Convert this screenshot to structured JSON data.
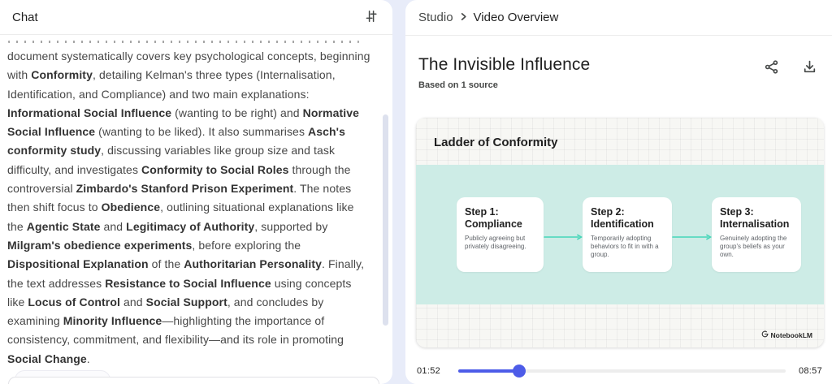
{
  "chat": {
    "title": "Chat",
    "summary_segments": [
      {
        "t": "document systematically covers key psychological concepts, beginning with ",
        "b": false
      },
      {
        "t": "Conformity",
        "b": true
      },
      {
        "t": ", detailing Kelman's three types (Internalisation, Identification, and Compliance) and two main explanations: ",
        "b": false
      },
      {
        "t": "Informational Social Influence",
        "b": true
      },
      {
        "t": " (wanting to be right) and ",
        "b": false
      },
      {
        "t": "Normative Social Influence",
        "b": true
      },
      {
        "t": " (wanting to be liked). It also summarises ",
        "b": false
      },
      {
        "t": "Asch's conformity study",
        "b": true
      },
      {
        "t": ", discussing variables like group size and task difficulty, and investigates ",
        "b": false
      },
      {
        "t": "Conformity to Social Roles",
        "b": true
      },
      {
        "t": " through the controversial ",
        "b": false
      },
      {
        "t": "Zimbardo's Stanford Prison Experiment",
        "b": true
      },
      {
        "t": ". The notes then shift focus to ",
        "b": false
      },
      {
        "t": "Obedience",
        "b": true
      },
      {
        "t": ", outlining situational explanations like the ",
        "b": false
      },
      {
        "t": "Agentic State",
        "b": true
      },
      {
        "t": " and ",
        "b": false
      },
      {
        "t": "Legitimacy of Authority",
        "b": true
      },
      {
        "t": ", supported by ",
        "b": false
      },
      {
        "t": "Milgram's obedience experiments",
        "b": true
      },
      {
        "t": ", before exploring the ",
        "b": false
      },
      {
        "t": "Dispositional Explanation",
        "b": true
      },
      {
        "t": " of the ",
        "b": false
      },
      {
        "t": "Authoritarian Personality",
        "b": true
      },
      {
        "t": ". Finally, the text addresses ",
        "b": false
      },
      {
        "t": "Resistance to Social Influence",
        "b": true
      },
      {
        "t": " using concepts like ",
        "b": false
      },
      {
        "t": "Locus of Control",
        "b": true
      },
      {
        "t": " and ",
        "b": false
      },
      {
        "t": "Social Support",
        "b": true
      },
      {
        "t": ", and concludes by examining ",
        "b": false
      },
      {
        "t": "Minority Influence",
        "b": true
      },
      {
        "t": "—highlighting the importance of consistency, commitment, and flexibility—and its role in promoting ",
        "b": false
      },
      {
        "t": "Social Change",
        "b": true
      },
      {
        "t": ".",
        "b": false
      }
    ]
  },
  "studio": {
    "breadcrumb": {
      "root": "Studio",
      "current": "Video Overview"
    },
    "title": "The Invisible Influence",
    "subtitle": "Based on 1 source",
    "video": {
      "slide_title": "Ladder of Conformity",
      "steps": [
        {
          "heading": "Step 1:",
          "name": "Compliance",
          "desc": "Publicly agreeing but privately disagreeing."
        },
        {
          "heading": "Step 2:",
          "name": "Identification",
          "desc": "Temporarily adopting behaviors to fit in with a group."
        },
        {
          "heading": "Step 3:",
          "name": "Internalisation",
          "desc": "Genuinely adopting the group's beliefs as your own."
        }
      ],
      "watermark": "NotebookLM"
    },
    "player": {
      "current_time": "01:52",
      "total_time": "08:57",
      "progress_pct": 18.5
    }
  },
  "icons": {
    "chat_settings": "tune-sliders-icon",
    "breadcrumb_separator": "chevron-right-icon",
    "share": "share-icon",
    "download": "download-icon",
    "watermark_logo": "notebooklm-logo-icon"
  },
  "colors": {
    "accent_blue": "#4d5ce8",
    "mint_band": "#cdece6",
    "arrow_teal": "#45d6b8",
    "background": "#e8ecf9"
  }
}
